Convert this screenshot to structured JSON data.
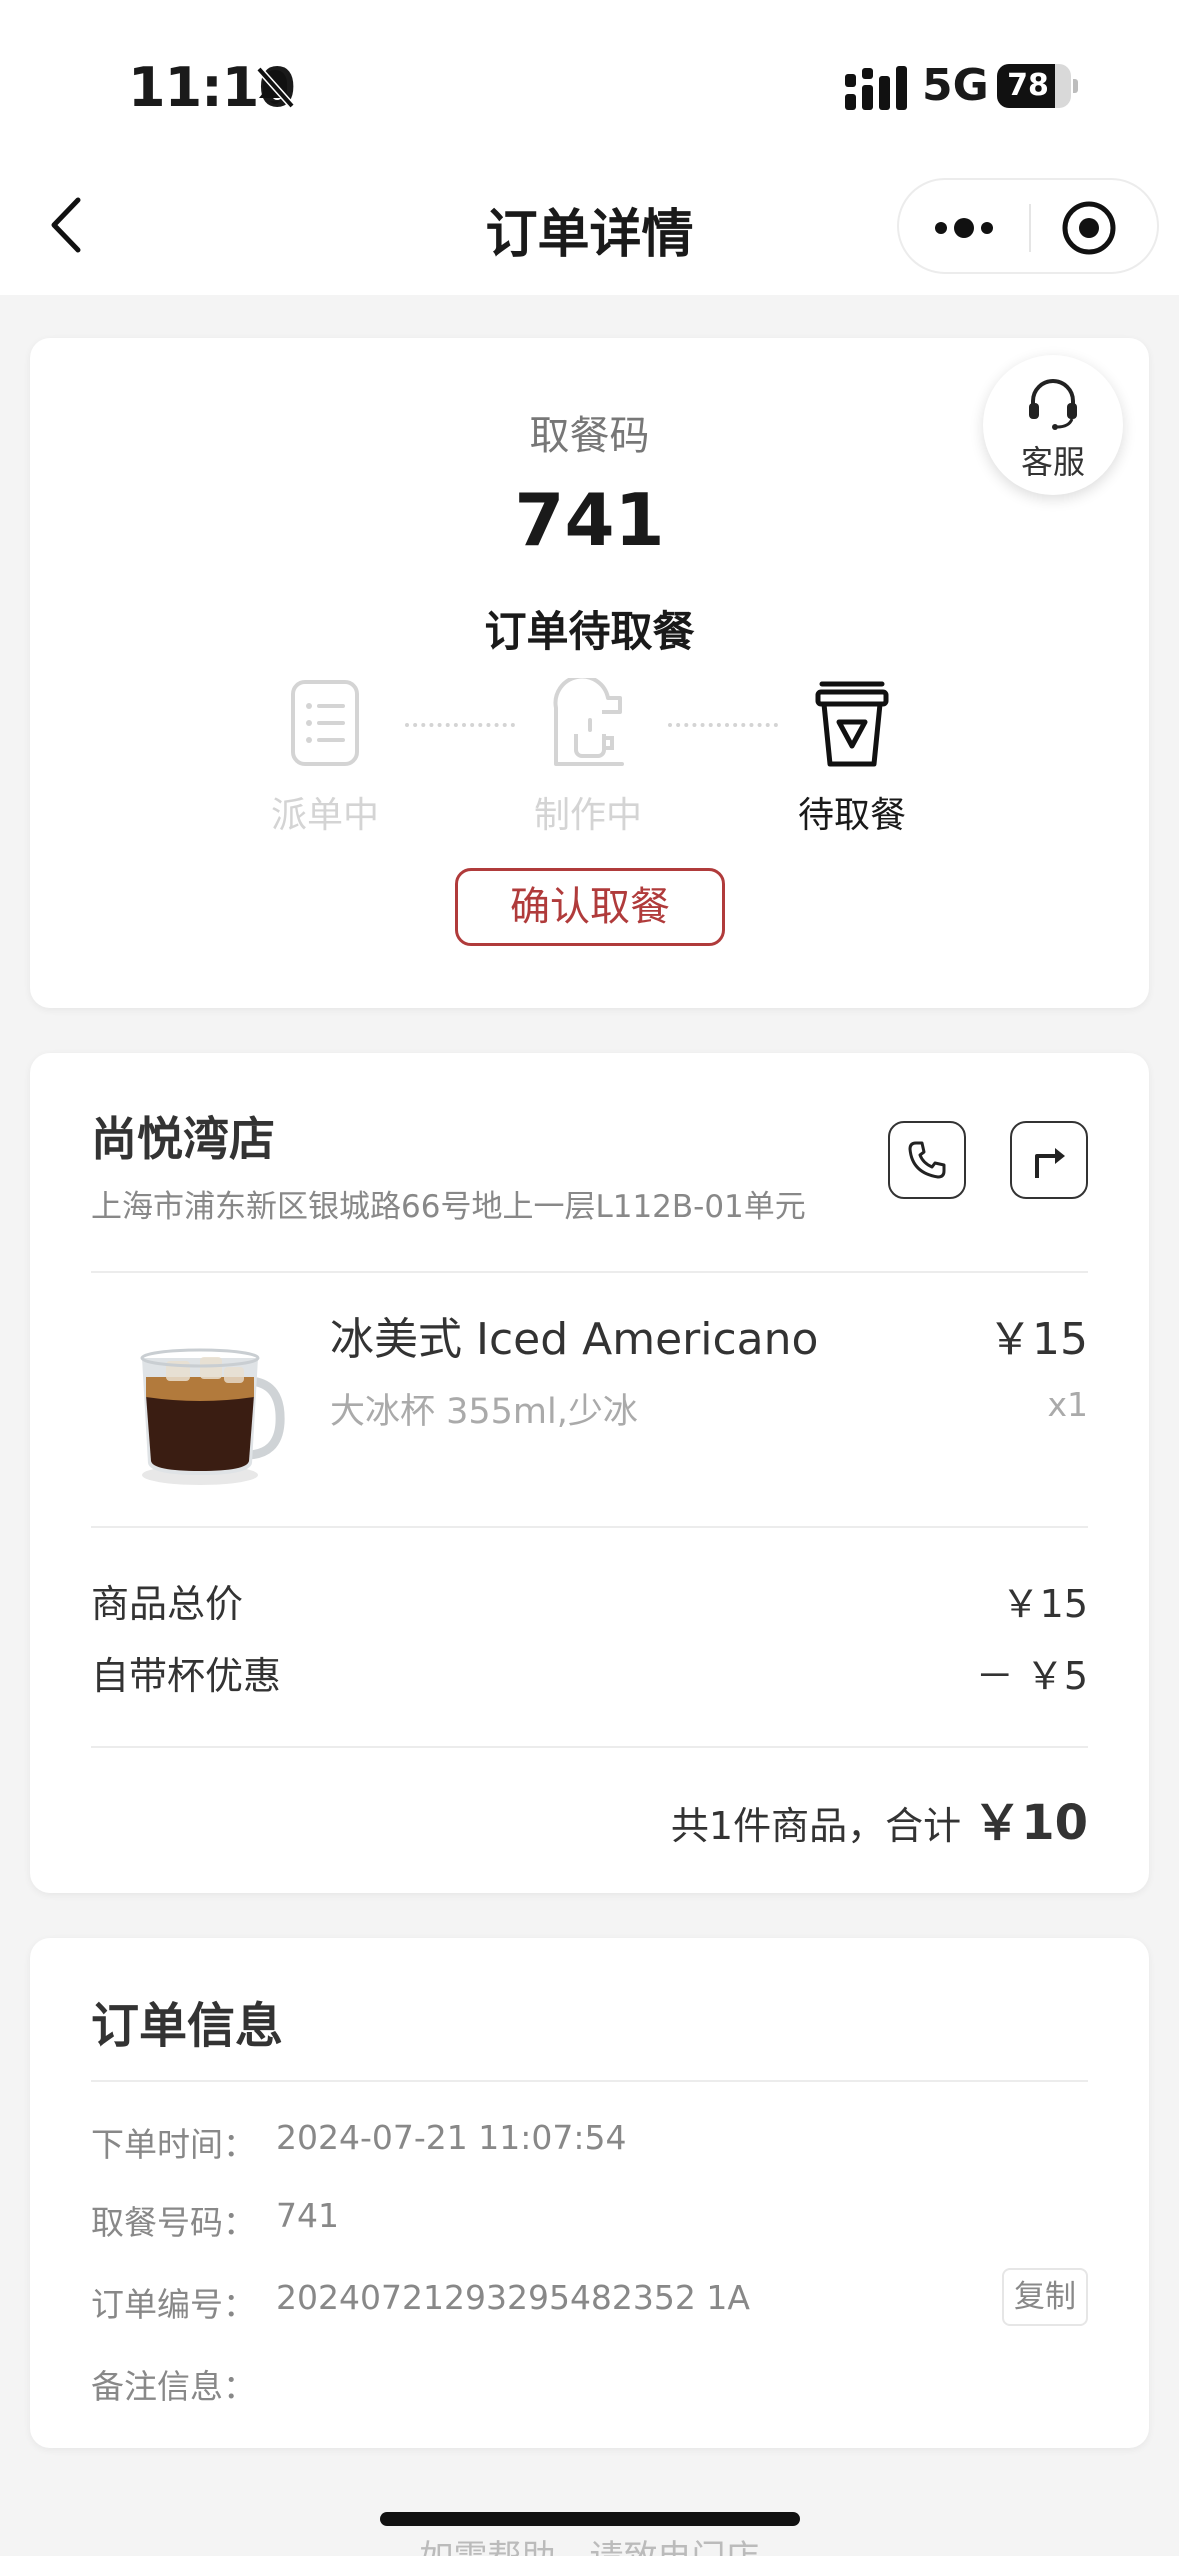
{
  "status_bar": {
    "time": "11:10",
    "network": "5G",
    "battery_level": "78",
    "battery_fraction": 0.78
  },
  "nav": {
    "title": "订单详情"
  },
  "pickup": {
    "code_label": "取餐码",
    "code": "741",
    "status_title": "订单待取餐",
    "customer_service_label": "客服",
    "steps": [
      {
        "label": "派单中",
        "state": "done-inactive",
        "icon": "order-list-icon"
      },
      {
        "label": "制作中",
        "state": "done-inactive",
        "icon": "coffee-machine-icon"
      },
      {
        "label": "待取餐",
        "state": "active",
        "icon": "takeaway-cup-icon"
      }
    ],
    "confirm_label": "确认取餐"
  },
  "store": {
    "name": "尚悦湾店",
    "address": "上海市浦东新区银城路66号地上一层L112B-01单元",
    "item": {
      "name": "冰美式 Iced Americano",
      "spec": "大冰杯 355ml,少冰",
      "price": "￥15",
      "qty": "x1"
    },
    "subtotal_label": "商品总价",
    "subtotal_value": "￥15",
    "discount_label": "自带杯优惠",
    "discount_value": "－ ￥5",
    "total_prefix": "共1件商品，合计",
    "total_amount": "￥10"
  },
  "order_info": {
    "title": "订单信息",
    "rows": [
      {
        "label": "下单时间：",
        "value": "2024-07-21 11:07:54"
      },
      {
        "label": "取餐号码：",
        "value": "741"
      },
      {
        "label": "订单编号：",
        "value": "20240721293295482352 1A"
      },
      {
        "label": "备注信息：",
        "value": ""
      }
    ],
    "copy_label": "复制"
  },
  "footer": {
    "hint": "如需帮助，请致电门店"
  },
  "colors": {
    "accent": "#b03b3b",
    "inactive": "#d4d4d4",
    "background": "#f4f4f4"
  }
}
